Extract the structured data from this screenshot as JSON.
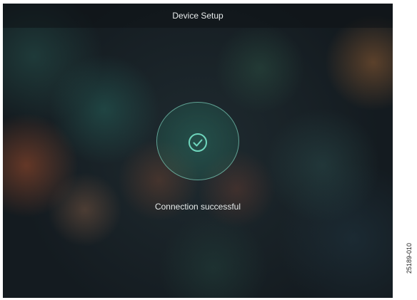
{
  "header": {
    "title": "Device Setup"
  },
  "status": {
    "message": "Connection successful",
    "icon": "check-circle-icon",
    "accent_color": "#6fd6bd"
  },
  "figure_id": "25189-010"
}
